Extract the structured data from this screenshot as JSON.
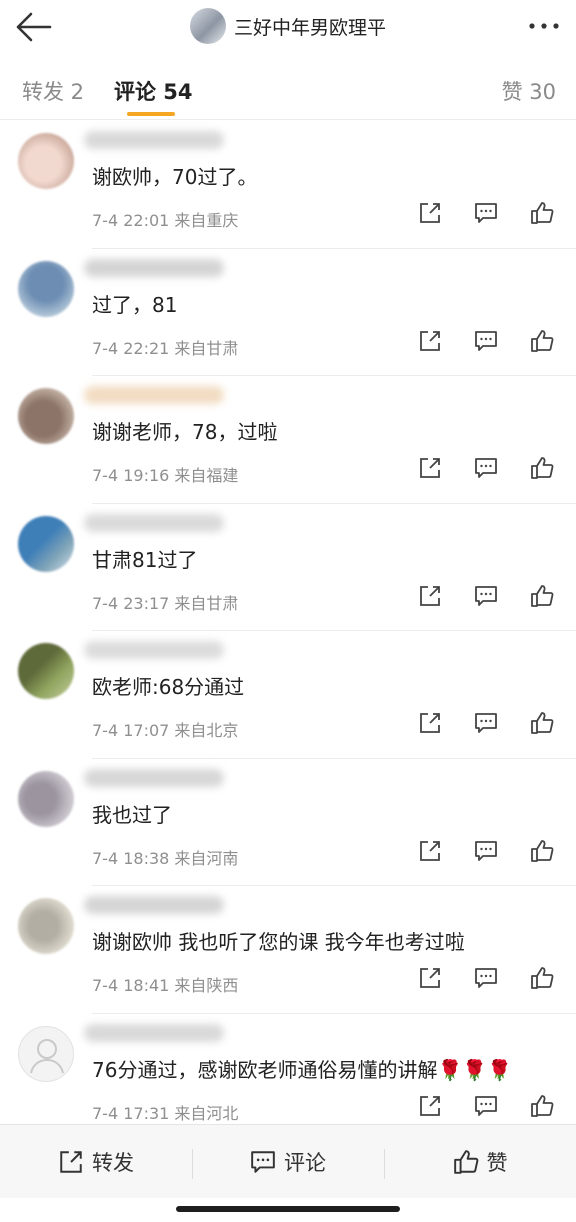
{
  "header": {
    "author_name": "三好中年男欧理平",
    "back_icon": "arrow-left-icon",
    "more_icon": "more-horizontal-icon"
  },
  "tabs": {
    "repost": "转发 2",
    "comments": "评论 54",
    "likes": "赞 30",
    "active_color": "#f5a623"
  },
  "comments": [
    {
      "text": "谢欧帅，70过了。",
      "meta": "7-4 22:01  来自重庆"
    },
    {
      "text": "过了，81",
      "meta": "7-4 22:21  来自甘肃"
    },
    {
      "text": "谢谢老师，78，过啦",
      "meta": "7-4 19:16  来自福建"
    },
    {
      "text": "甘肃81过了",
      "meta": "7-4 23:17  来自甘肃"
    },
    {
      "text": "欧老师:68分通过",
      "meta": "7-4 17:07  来自北京"
    },
    {
      "text": "我也过了",
      "meta": "7-4 18:38  来自河南"
    },
    {
      "text": "谢谢欧帅 我也听了您的课 我今年也考过啦",
      "meta": "7-4 18:41  来自陕西"
    },
    {
      "text": "76分通过，感谢欧老师通俗易懂的讲解🌹🌹🌹",
      "meta": "7-4 17:31  来自河北"
    }
  ],
  "bottom_bar": {
    "repost": "转发",
    "comment": "评论",
    "like": "赞"
  }
}
